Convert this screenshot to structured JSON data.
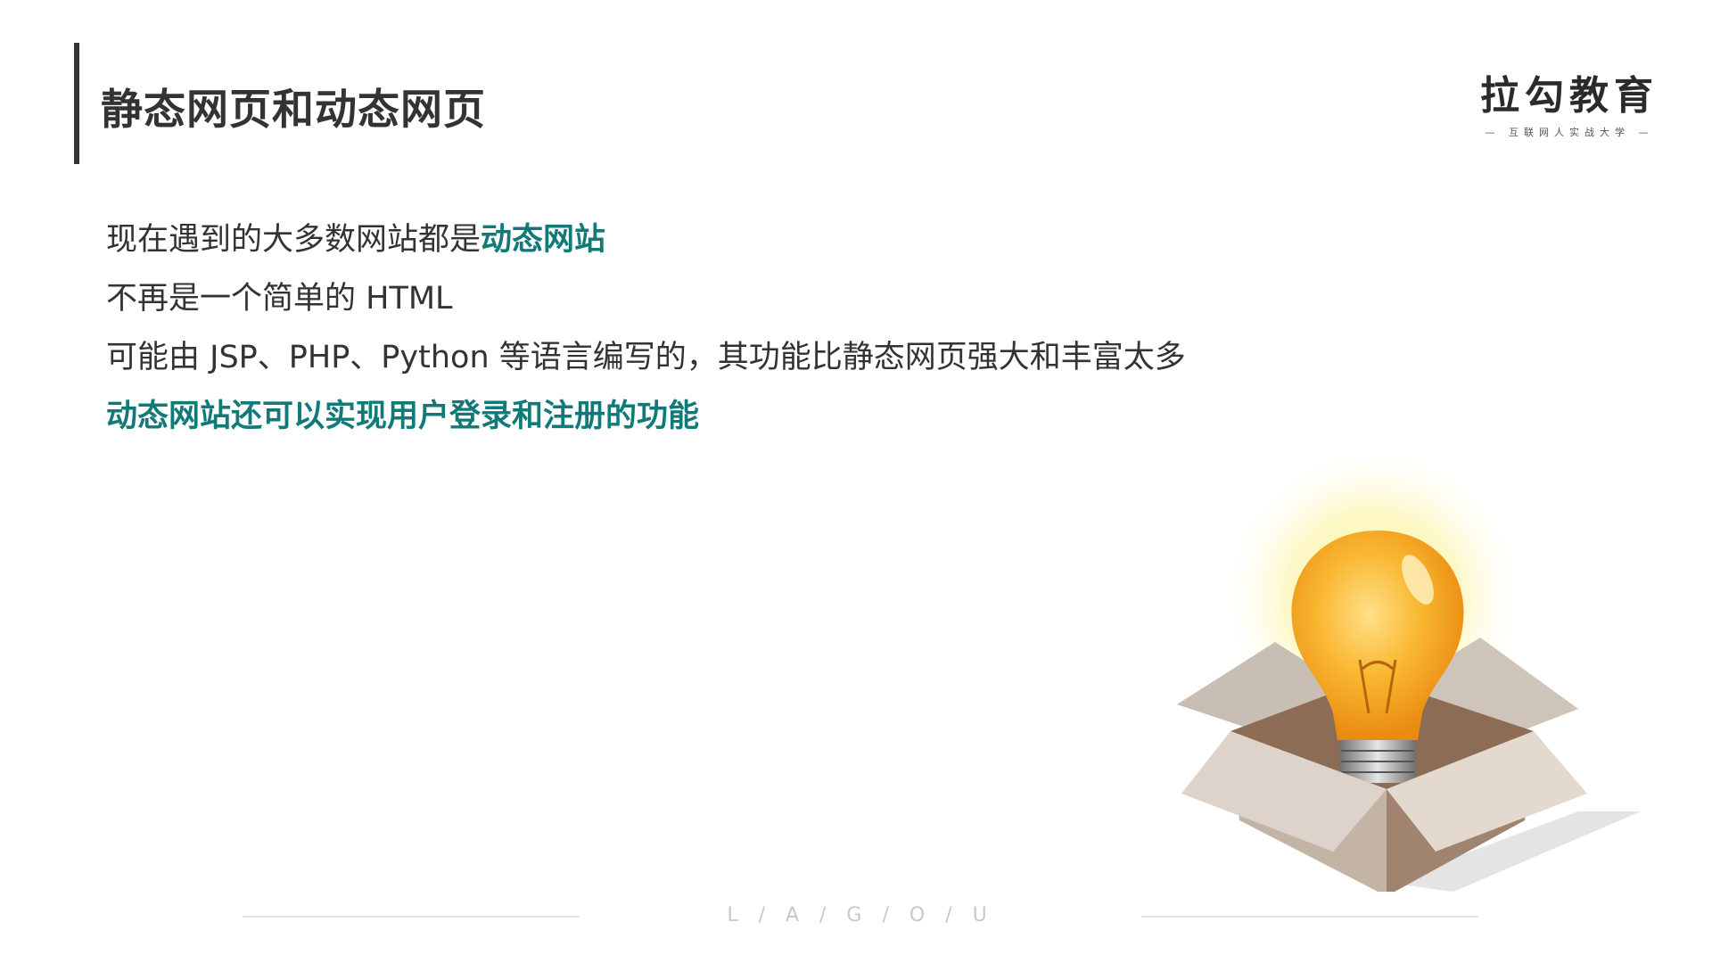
{
  "slide": {
    "title": "静态网页和动态网页"
  },
  "logo": {
    "name": "拉勾教育",
    "tagline": "— 互联网人实战大学 —"
  },
  "content": {
    "line1_prefix": "现在遇到的大多数网站都是",
    "line1_highlight": "动态网站",
    "line2": "不再是一个简单的 HTML",
    "line3": "可能由 JSP、PHP、Python 等语言编写的，其功能比静态网页强大和丰富太多",
    "line4": "动态网站还可以实现用户登录和注册的功能"
  },
  "footer": {
    "text": "L / A / G / O / U"
  },
  "colors": {
    "accent": "#0f7a78",
    "text": "#333333",
    "box": "#d8cfc6",
    "bulb": "#f7a41a"
  },
  "illustration": {
    "name": "lightbulb-in-box"
  }
}
